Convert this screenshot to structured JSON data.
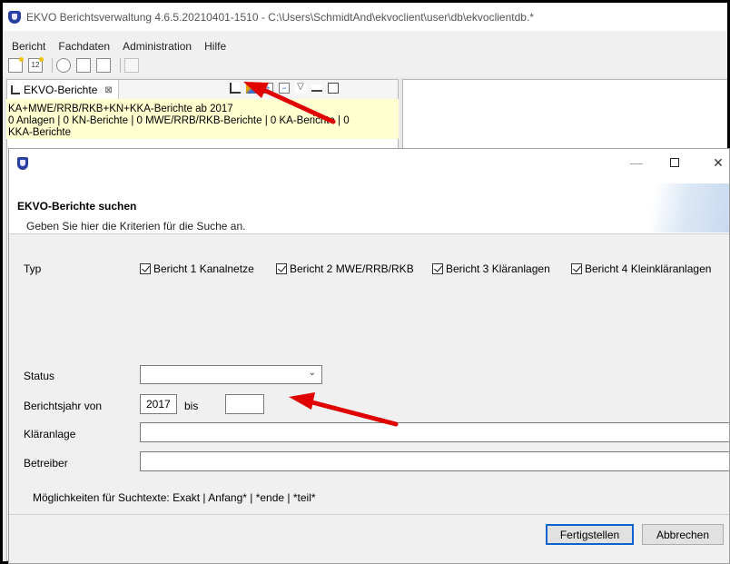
{
  "app": {
    "title": "EKVO Berichtsverwaltung 4.6.5.20210401-1510 - C:\\Users\\SchmidtAnd\\ekvoclient\\user\\db\\ekvoclientdb.*"
  },
  "menu": [
    "Bericht",
    "Fachdaten",
    "Administration",
    "Hilfe"
  ],
  "toolbar_icons": [
    "new-icon",
    "new-report-icon",
    "search-icon",
    "print-preview-icon",
    "print-icon",
    "save-icon"
  ],
  "view": {
    "tab_label": "EKVO-Berichte",
    "tab_close": "⊠",
    "summary_line1": "KA+MWE/RRB/RKB+KN+KKA-Berichte ab 2017",
    "summary_line2": "0 Anlagen | 0 KN-Berichte | 0 MWE/RRB/RKB-Berichte | 0 KA-Berichte | 0",
    "summary_line3": "KKA-Berichte"
  },
  "dialog": {
    "title": "EKVO-Berichte suchen",
    "subtitle": "Geben Sie hier die Kriterien für die Suche an.",
    "typ_label": "Typ",
    "checkboxes": [
      {
        "label": "Bericht 1 Kanalnetze",
        "checked": true
      },
      {
        "label": "Bericht 2 MWE/RRB/RKB",
        "checked": true
      },
      {
        "label": "Bericht 3 Kläranlagen",
        "checked": true
      },
      {
        "label": "Bericht 4 Kleinkläranlagen",
        "checked": true
      }
    ],
    "status_label": "Status",
    "status_value": "",
    "jahr_label": "Berichtsjahr von",
    "jahr_von": "2017",
    "bis_label": "bis",
    "jahr_bis": "",
    "klaeranlage_label": "Kläranlage",
    "klaeranlage_value": "",
    "betreiber_label": "Betreiber",
    "betreiber_value": "",
    "hint": "Möglichkeiten für Suchtexte: Exakt | Anfang* | *ende | *teil*",
    "finish_button": "Fertigstellen",
    "cancel_button": "Abbrechen"
  },
  "colors": {
    "summary_bg": "#ffffd0",
    "arrow": "#e00000",
    "default_button_border": "#0a63d0"
  }
}
